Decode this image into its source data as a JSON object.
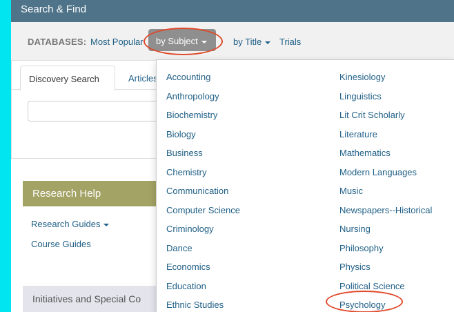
{
  "header": {
    "title": "Search & Find"
  },
  "subnav": {
    "label": "DATABASES:",
    "most_popular": "Most Popular",
    "by_subject": "by Subject",
    "by_title": "by Title",
    "trials": "Trials"
  },
  "tabs": {
    "active": "Discovery Search",
    "second": "Articles"
  },
  "sidebar": {
    "research_help": "Research Help",
    "research_guides": "Research Guides",
    "course_guides": "Course Guides",
    "initiatives": "Initiatives and Special Co"
  },
  "dropdown": {
    "left": [
      "Accounting",
      "Anthropology",
      "Biochemistry",
      "Biology",
      "Business",
      "Chemistry",
      "Communication",
      "Computer Science",
      "Criminology",
      "Dance",
      "Economics",
      "Education",
      "Ethnic Studies"
    ],
    "right": [
      "Kinesiology",
      "Linguistics",
      "Lit Crit Scholarly",
      "Literature",
      "Mathematics",
      "Modern Languages",
      "Music",
      "Newspapers--Historical",
      "Nursing",
      "Philosophy",
      "Physics",
      "Political Science",
      "Psychology"
    ]
  },
  "colors": {
    "frame_bg": "#00e5f0",
    "header_bg": "#4f7389",
    "link": "#1f5f86",
    "research_help_bg": "#a3a365",
    "annotation_circle": "#e0492a"
  }
}
